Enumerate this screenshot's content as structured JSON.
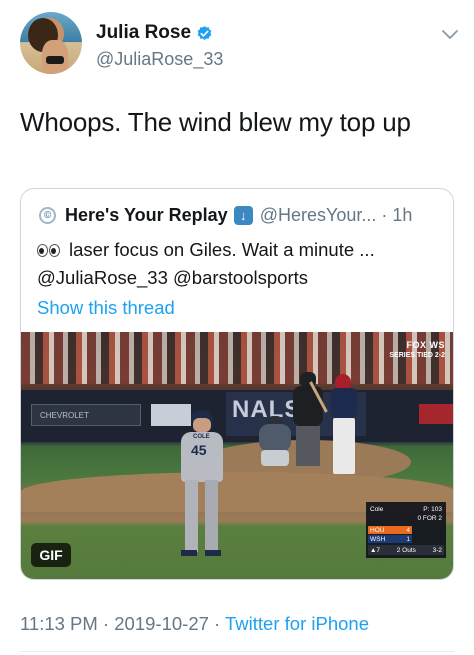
{
  "author": {
    "display_name": "Julia Rose",
    "handle": "@JuliaRose_33",
    "verified": true
  },
  "tweet": {
    "text": "Whoops. The wind blew my top up"
  },
  "quoted_tweet": {
    "display_name": "Here's Your Replay",
    "name_emoji": "down-arrow-emoji",
    "handle": "@HeresYour...",
    "separator": "·",
    "time": "1h",
    "line1": "laser focus on Giles.  Wait a minute ...",
    "line2": "@JuliaRose_33 @barstoolsports",
    "show_thread": "Show this thread",
    "media": {
      "gif_label": "GIF",
      "broadcast": {
        "network": "FOX WS",
        "series_status": "SERIES TIED 2-2"
      },
      "ads": {
        "left": "CHEVROLET",
        "center": "NALS"
      },
      "pitcher_jersey": {
        "name": "COLE",
        "number": "45"
      },
      "scorebug": {
        "pitcher": "Cole",
        "pitch_count": "P: 103",
        "teams": [
          {
            "abbr": "HOU",
            "score": "4"
          },
          {
            "abbr": "WSH",
            "score": "1"
          }
        ],
        "inning": "▲7",
        "outs": "2 Outs",
        "count": "3-2",
        "batter_line": "0 FOR 2"
      }
    }
  },
  "footer": {
    "time": "11:13 PM",
    "date": "2019-10-27",
    "separator": "·",
    "source": "Twitter for iPhone"
  },
  "colors": {
    "link_blue": "#1da1f2",
    "muted_gray": "#657786",
    "border": "#ccd6dd",
    "verified_blue": "#1da1f2"
  },
  "icons": {
    "verified": "verified-badge-icon",
    "more": "chevron-down-icon",
    "eyes": "eyes-emoji"
  }
}
